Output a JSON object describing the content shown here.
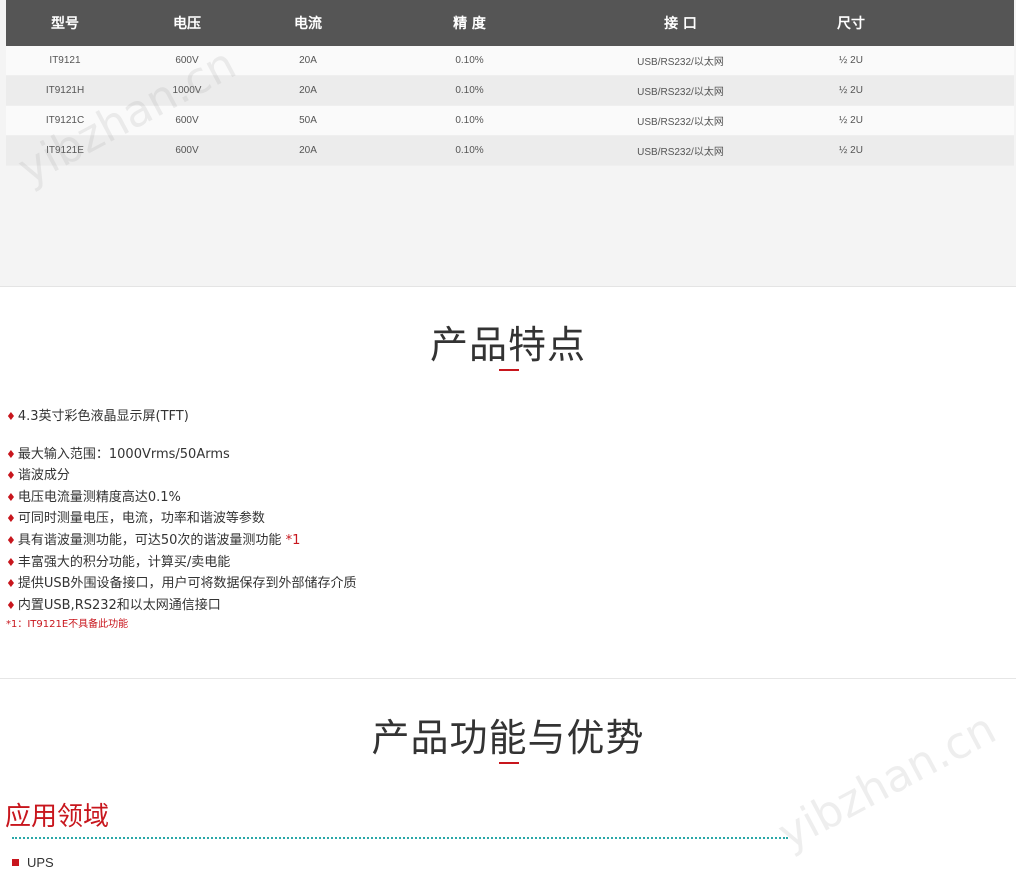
{
  "spec_table": {
    "headers": [
      "型号",
      "电压",
      "电流",
      "精 度",
      "接 口",
      "尺寸",
      ""
    ],
    "rows": [
      [
        "IT9121",
        "600V",
        "20A",
        "0.10%",
        "USB/RS232/以太网",
        "½ 2U",
        ""
      ],
      [
        "IT9121H",
        "1000V",
        "20A",
        "0.10%",
        "USB/RS232/以太网",
        "½ 2U",
        ""
      ],
      [
        "IT9121C",
        "600V",
        "50A",
        "0.10%",
        "USB/RS232/以太网",
        "½ 2U",
        ""
      ],
      [
        "IT9121E",
        "600V",
        "20A",
        "0.10%",
        "USB/RS232/以太网",
        "½ 2U",
        ""
      ]
    ]
  },
  "features_section": {
    "title": "产品特点",
    "items": [
      "4.3英寸彩色液晶显示屏(TFT)",
      "最大输入范围：1000Vrms/50Arms",
      "谐波成分",
      "电压电流量测精度高达0.1%",
      "可同时测量电压，电流，功率和谐波等参数",
      "具有谐波量测功能，可达50次的谐波量测功能",
      "丰富强大的积分功能，计算买/卖电能",
      "提供USB外围设备接口，用户可将数据保存到外部储存介质",
      "内置USB,RS232和以太网通信接口"
    ],
    "item_note": "*1",
    "footnote": "*1：IT9121E不具备此功能",
    "bullet_glyph": "♦"
  },
  "advantages_section": {
    "title": "产品功能与优势",
    "application_title": "应用领域",
    "applications": [
      "UPS"
    ]
  },
  "watermarks": [
    "yibzhan.cn",
    "yibzhan.cn"
  ],
  "colors": {
    "accent": "#c8161d",
    "header_bg": "#555555",
    "dotted_line": "#2aa8a8"
  }
}
